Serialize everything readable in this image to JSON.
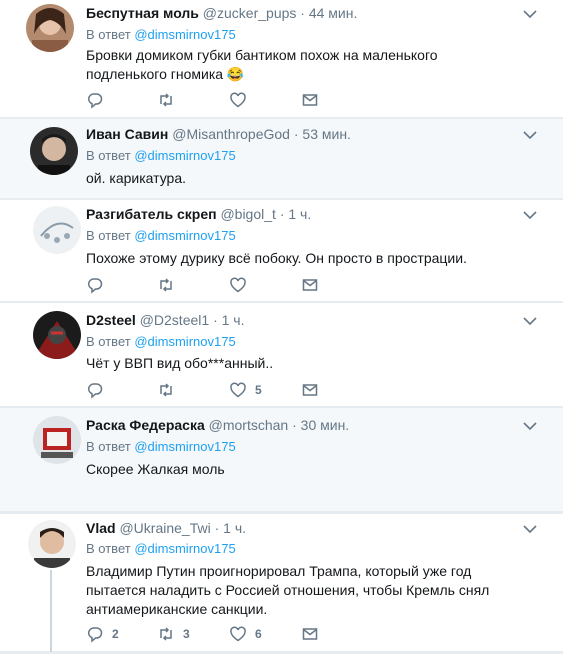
{
  "tweets": [
    {
      "name": "Беспутная моль",
      "handle": "@zucker_pups",
      "dot": "·",
      "time": "44 мин.",
      "reply_prefix": "В ответ",
      "reply_mention": "@dimsmirnov175",
      "text": "Бровки домиком губки бантиком похож на маленького подленького гномика 😂",
      "counts": {
        "reply": "",
        "retweet": "",
        "like": ""
      }
    },
    {
      "name": "Иван Савин",
      "handle": "@MisanthropeGod",
      "dot": "·",
      "time": "53 мин.",
      "reply_prefix": "В ответ",
      "reply_mention": "@dimsmirnov175",
      "text": "ой. карикатура.",
      "counts": {
        "reply": "",
        "retweet": "",
        "like": ""
      }
    },
    {
      "name": "Разгибатель скреп",
      "handle": "@bigol_t",
      "dot": "·",
      "time": "1 ч.",
      "reply_prefix": "В ответ",
      "reply_mention": "@dimsmirnov175",
      "text": "Похоже этому дурику всё побоку. Он просто в прострации.",
      "counts": {
        "reply": "",
        "retweet": "",
        "like": ""
      }
    },
    {
      "name": "D2steel",
      "handle": "@D2steel1",
      "dot": "·",
      "time": "1 ч.",
      "reply_prefix": "В ответ",
      "reply_mention": "@dimsmirnov175",
      "text": "Чёт у ВВП вид обо***анный..",
      "counts": {
        "reply": "",
        "retweet": "",
        "like": "5"
      }
    },
    {
      "name": "Раска Федераска",
      "handle": "@mortschan",
      "dot": "·",
      "time": "30 мин.",
      "reply_prefix": "В ответ",
      "reply_mention": "@dimsmirnov175",
      "text": "Скорее Жалкая моль",
      "counts": {
        "reply": "",
        "retweet": "",
        "like": ""
      }
    },
    {
      "name": "Vlad",
      "handle": "@Ukraine_Twi",
      "dot": "·",
      "time": "1 ч.",
      "reply_prefix": "В ответ",
      "reply_mention": "@dimsmirnov175",
      "text": "Владимир Путин проигнорировал Трампа, который  уже год пытается наладить с Россией отношения, чтобы Кремль снял антиамериканские санкции.",
      "counts": {
        "reply": "2",
        "retweet": "3",
        "like": "6"
      }
    }
  ],
  "colors": {
    "accent": "#1da1f2",
    "muted": "#657786",
    "text": "#14171a",
    "tint": "#f5f8fa",
    "border": "#e6ecf0"
  },
  "icons": [
    "chevron-down-icon",
    "reply-icon",
    "retweet-icon",
    "like-icon",
    "direct-message-icon"
  ]
}
